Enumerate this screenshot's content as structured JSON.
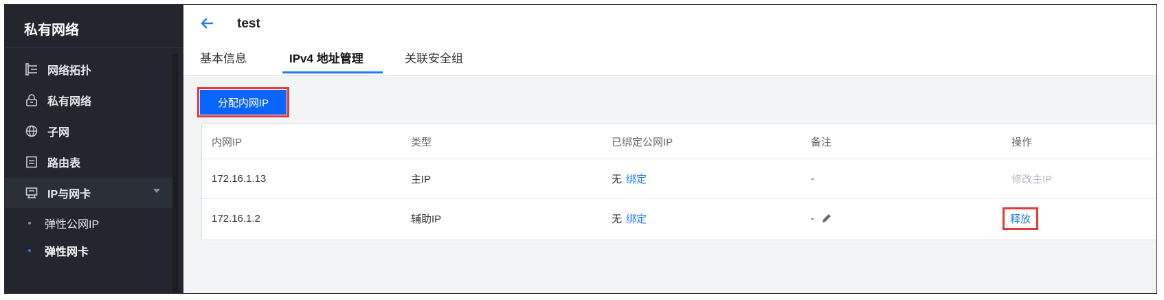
{
  "sidebar": {
    "title": "私有网络",
    "items": [
      {
        "label": "网络拓扑",
        "icon": "topology-icon"
      },
      {
        "label": "私有网络",
        "icon": "lock-icon"
      },
      {
        "label": "子网",
        "icon": "globe-icon"
      },
      {
        "label": "路由表",
        "icon": "document-icon"
      },
      {
        "label": "IP与网卡",
        "icon": "network-card-icon"
      }
    ],
    "subitems": [
      {
        "label": "弹性公网IP"
      },
      {
        "label": "弹性网卡"
      }
    ]
  },
  "header": {
    "title": "test",
    "tabs": [
      {
        "label": "基本信息"
      },
      {
        "label": "IPv4 地址管理"
      },
      {
        "label": "关联安全组"
      }
    ]
  },
  "toolbar": {
    "assign_label": "分配内网IP"
  },
  "table": {
    "columns": [
      "内网IP",
      "类型",
      "已绑定公网IP",
      "备注",
      "操作"
    ],
    "rows": [
      {
        "ip": "172.16.1.13",
        "type": "主IP",
        "public": "无",
        "bind": "绑定",
        "note": "-",
        "action": "修改主IP"
      },
      {
        "ip": "172.16.1.2",
        "type": "辅助IP",
        "public": "无",
        "bind": "绑定",
        "note": "-",
        "action": "释放"
      }
    ]
  },
  "colors": {
    "accent": "#1c7cf2",
    "primary_button": "#0a64ff",
    "highlight": "#e53935",
    "sidebar_bg": "#23262e"
  }
}
